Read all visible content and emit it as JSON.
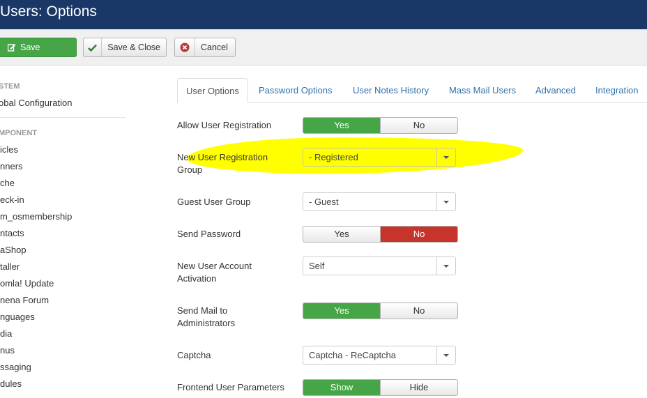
{
  "header": {
    "title": "Users: Options"
  },
  "toolbar": {
    "save": "Save",
    "save_close": "Save & Close",
    "cancel": "Cancel"
  },
  "sidebar": {
    "system_heading": "STEM",
    "system_items": [
      "obal Configuration"
    ],
    "component_heading": "MPONENT",
    "component_items": [
      "icles",
      "nners",
      "che",
      "eck-in",
      "m_osmembership",
      "ntacts",
      "aShop",
      "taller",
      "omla! Update",
      "nena Forum",
      "nguages",
      "dia",
      "nus",
      "ssaging",
      "dules"
    ]
  },
  "tabs": [
    {
      "label": "User Options",
      "active": true
    },
    {
      "label": "Password Options",
      "active": false
    },
    {
      "label": "User Notes History",
      "active": false
    },
    {
      "label": "Mass Mail Users",
      "active": false
    },
    {
      "label": "Advanced",
      "active": false
    },
    {
      "label": "Integration",
      "active": false
    }
  ],
  "form": {
    "allow_registration": {
      "label": "Allow User Registration",
      "yes": "Yes",
      "no": "No",
      "value": "Yes"
    },
    "new_user_group": {
      "label_line1": "New User Registration",
      "label_line2": "Group",
      "value": "- Registered"
    },
    "guest_group": {
      "label": "Guest User Group",
      "value": "- Guest"
    },
    "send_password": {
      "label": "Send Password",
      "yes": "Yes",
      "no": "No",
      "value": "No"
    },
    "account_activation": {
      "label_line1": "New User Account",
      "label_line2": "Activation",
      "value": "Self"
    },
    "send_mail_admins": {
      "label_line1": "Send Mail to",
      "label_line2": "Administrators",
      "yes": "Yes",
      "no": "No",
      "value": "Yes"
    },
    "captcha": {
      "label": "Captcha",
      "value": "Captcha - ReCaptcha"
    },
    "frontend_params": {
      "label": "Frontend User Parameters",
      "show": "Show",
      "hide": "Hide",
      "value": "Show"
    }
  },
  "colors": {
    "header_bg": "#1a3867",
    "green": "#46a546",
    "red": "#c6342b",
    "link": "#3071a9",
    "highlight": "#ffff00"
  }
}
